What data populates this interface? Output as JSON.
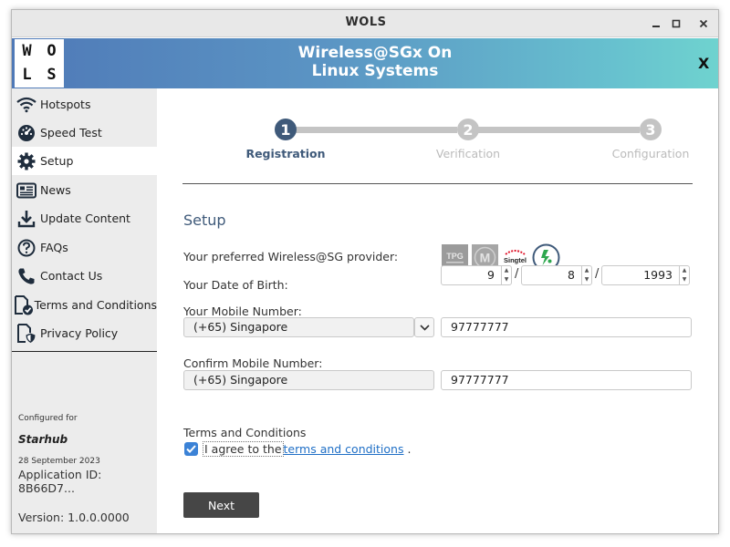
{
  "window": {
    "title": "WOLS"
  },
  "header": {
    "logo_letters": [
      "W",
      "O",
      "L",
      "S"
    ],
    "title_line1": "Wireless@SGx On",
    "title_line2": "Linux Systems",
    "close_label": "X"
  },
  "sidebar": {
    "items": [
      {
        "label": "Hotspots",
        "icon": "wifi-icon"
      },
      {
        "label": "Speed Test",
        "icon": "speedometer-icon"
      },
      {
        "label": "Setup",
        "icon": "gear-icon",
        "active": true
      },
      {
        "label": "News",
        "icon": "newspaper-icon"
      },
      {
        "label": "Update Content",
        "icon": "download-icon"
      },
      {
        "label": "FAQs",
        "icon": "question-icon"
      },
      {
        "label": "Contact Us",
        "icon": "phone-icon"
      },
      {
        "label": "Terms and Conditions",
        "icon": "document-check-icon"
      },
      {
        "label": "Privacy Policy",
        "icon": "document-shield-icon"
      }
    ],
    "configured_for_label": "Configured for",
    "carrier": "Starhub",
    "date": "28 September 2023",
    "application_id": "Application ID: 8B66D7...",
    "version": "Version: 1.0.0.0000"
  },
  "steps": [
    {
      "number": "1",
      "label": "Registration",
      "active": true
    },
    {
      "number": "2",
      "label": "Verification",
      "active": false
    },
    {
      "number": "3",
      "label": "Configuration",
      "active": false
    }
  ],
  "form": {
    "section_title": "Setup",
    "provider_label": "Your preferred Wireless@SG provider:",
    "providers": [
      {
        "name": "TPG",
        "icon": "tpg-logo-icon"
      },
      {
        "name": "M",
        "icon": "m1-logo-icon"
      },
      {
        "name": "Singtel",
        "icon": "singtel-logo-icon"
      },
      {
        "name": "Starhub",
        "icon": "starhub-logo-icon",
        "selected": true
      }
    ],
    "dob_label": "Your Date of Birth:",
    "dob_day": "9",
    "dob_month": "8",
    "dob_year": "1993",
    "date_separator": "/",
    "mobile_label": "Your Mobile Number:",
    "mobile_country": "(+65) Singapore",
    "mobile_number": "97777777",
    "confirm_label": "Confirm Mobile Number:",
    "confirm_country": "(+65) Singapore",
    "confirm_number": "97777777",
    "terms_title": "Terms and Conditions",
    "agree_prefix": "I agree to the",
    "agree_link": "terms and conditions",
    "agree_suffix": " .",
    "agree_checked": true,
    "next_label": "Next"
  },
  "colors": {
    "accent": "#3f5a7a",
    "checkbox": "#3b82d6",
    "link": "#1f6fc6",
    "button": "#464646"
  }
}
